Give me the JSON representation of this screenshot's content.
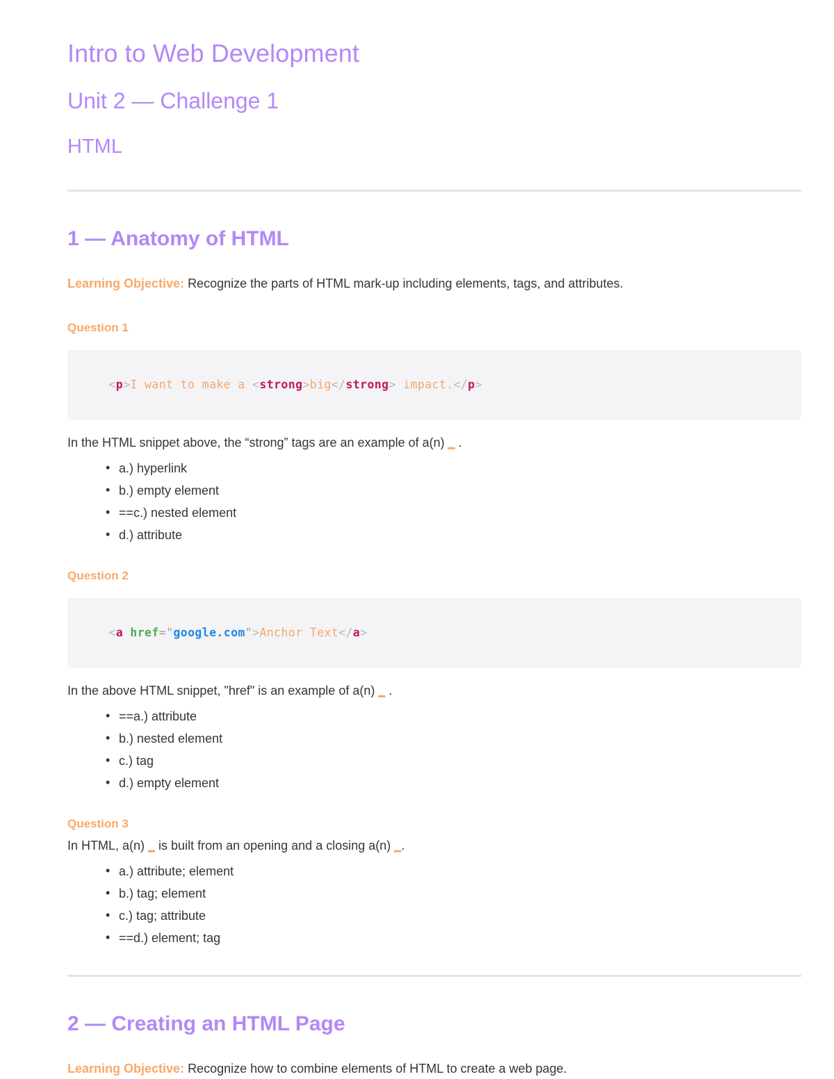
{
  "doc": {
    "title": "Intro to Web Development",
    "subtitle": "Unit 2 — Challenge 1",
    "topic": "HTML"
  },
  "colors": {
    "heading_purple": "#b388f7",
    "label_orange": "#f9a869",
    "body_text": "#37352f",
    "code_bg": "#f4f4f6",
    "rule": "#e3e3e3",
    "code_tag": "#c2185b",
    "code_text": "#f5a76b",
    "code_attr": "#4caf50",
    "code_string": "#1e88e5",
    "code_punct": "#b8b8b8"
  },
  "sections": [
    {
      "heading": "1 — Anatomy of HTML",
      "objective_label": "Learning Objective:",
      "objective_text": "Recognize the parts of HTML mark-up including elements, tags, and attributes.",
      "questions": [
        {
          "label": "Question 1",
          "code_plain": "<p>I want to make a <strong>big</strong> impact.</p>",
          "code_tokens": [
            {
              "t": "<",
              "c": "punct"
            },
            {
              "t": "p",
              "c": "tag"
            },
            {
              "t": ">",
              "c": "punct"
            },
            {
              "t": "I want to make a ",
              "c": "text"
            },
            {
              "t": "<",
              "c": "punct"
            },
            {
              "t": "strong",
              "c": "tag"
            },
            {
              "t": ">",
              "c": "punct"
            },
            {
              "t": "big",
              "c": "text"
            },
            {
              "t": "</",
              "c": "punct"
            },
            {
              "t": "strong",
              "c": "tag"
            },
            {
              "t": ">",
              "c": "punct"
            },
            {
              "t": " impact.",
              "c": "text"
            },
            {
              "t": "</",
              "c": "punct"
            },
            {
              "t": "p",
              "c": "tag"
            },
            {
              "t": ">",
              "c": "punct"
            }
          ],
          "prompt_before": "In the HTML snippet above, the “strong” tags are an example of a(n) ",
          "prompt_blank": "_",
          "prompt_after": " .",
          "choices": [
            "a.) hyperlink",
            "b.) empty element",
            "==c.) nested element",
            "d.) attribute"
          ]
        },
        {
          "label": "Question 2",
          "code_plain": "<a href=\"google.com\">Anchor Text</a>",
          "code_tokens": [
            {
              "t": "<",
              "c": "punct"
            },
            {
              "t": "a",
              "c": "tag"
            },
            {
              "t": " ",
              "c": "punct"
            },
            {
              "t": "href",
              "c": "attr"
            },
            {
              "t": "=",
              "c": "quote"
            },
            {
              "t": "\"",
              "c": "quote"
            },
            {
              "t": "google.com",
              "c": "str"
            },
            {
              "t": "\"",
              "c": "quote"
            },
            {
              "t": ">",
              "c": "punct"
            },
            {
              "t": "Anchor Text",
              "c": "text"
            },
            {
              "t": "</",
              "c": "punct"
            },
            {
              "t": "a",
              "c": "tag"
            },
            {
              "t": ">",
              "c": "punct"
            }
          ],
          "prompt_before": "In the above HTML snippet, \"href\" is an example of a(n) ",
          "prompt_blank": "_",
          "prompt_after": " .",
          "choices": [
            "==a.) attribute",
            "b.) nested element",
            "c.) tag",
            "d.) empty element"
          ]
        },
        {
          "label": "Question 3",
          "prompt_before": "In HTML, a(n) ",
          "prompt_blank": "_",
          "prompt_mid": " is built from an opening and a closing a(n) ",
          "prompt_blank2": "_",
          "prompt_after": ".",
          "choices": [
            "a.) attribute; element",
            "b.) tag; element",
            "c.) tag; attribute",
            "==d.) element; tag"
          ]
        }
      ]
    },
    {
      "heading": "2 — Creating an HTML Page",
      "objective_label": "Learning Objective:",
      "objective_text": "Recognize how to combine elements of HTML to create a web page."
    }
  ]
}
